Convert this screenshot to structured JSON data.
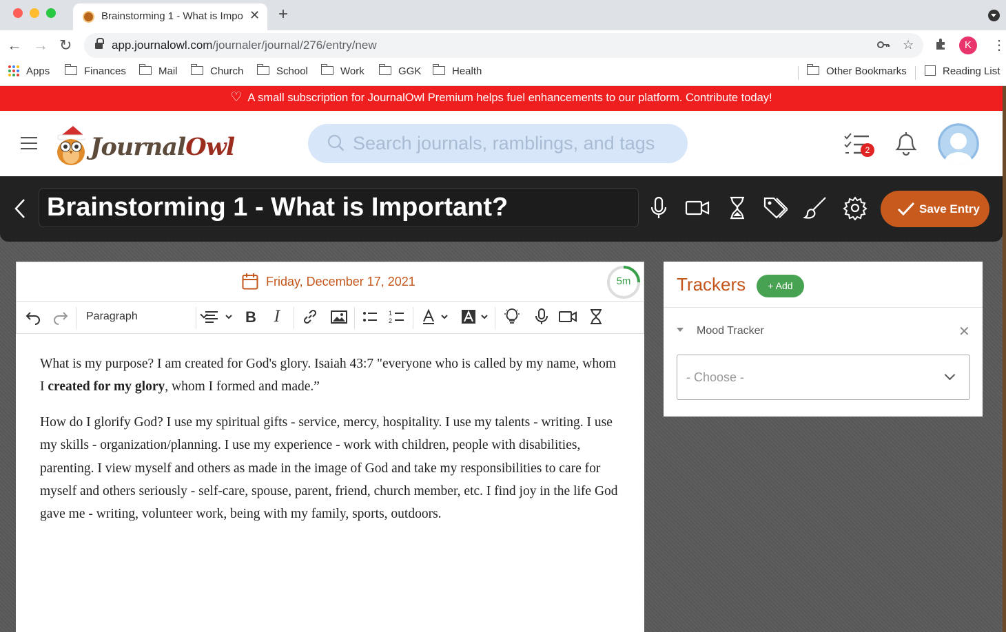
{
  "browser": {
    "tab_title": "Brainstorming 1 - What is Impo",
    "url_host": "app.journalowl.com",
    "url_path": "/journaler/journal/276/entry/new",
    "profile_initial": "K",
    "bookmarks": [
      "Apps",
      "Finances",
      "Mail",
      "Church",
      "School",
      "Work",
      "GGK",
      "Health"
    ],
    "other_bookmarks": "Other Bookmarks",
    "reading_list": "Reading List"
  },
  "banner": {
    "text": "A small subscription for JournalOwl Premium helps fuel enhancements to our platform. Contribute today!",
    "color": "#f01f1f"
  },
  "header": {
    "logo_part1": "Journal",
    "logo_part2": "Owl",
    "search_placeholder": "Search journals, ramblings, and tags",
    "task_badge": "2"
  },
  "entry": {
    "title": "Brainstorming 1 - What is Important?",
    "save_label": "Save Entry",
    "accent": "#c85a1e",
    "toolbar_icons": [
      "microphone-icon",
      "video-icon",
      "hourglass-icon",
      "tags-icon",
      "brush-icon",
      "gear-icon"
    ]
  },
  "editor": {
    "date": "Friday, December 17, 2021",
    "timer": "5m",
    "timer_progress": 0.25,
    "paragraph_style": "Paragraph",
    "p1_a": "What is my purpose? I am created for God's glory. Isaiah 43:7 \"everyone who is called by my name, whom I ",
    "p1_bold": "created for my glory",
    "p1_b": ", whom I formed and made.”",
    "p2": "How do I glorify God? I use my spiritual gifts - service, mercy, hospitality. I use my talents - writing. I use my skills - organization/planning. I use my experience - work with children, people with disabilities, parenting. I view myself and others as made in the image of God and take my responsibilities to care for myself and others seriously - self-care, spouse, parent, friend, church member, etc. I find joy in the life God gave me - writing, volunteer work, being with my family, sports, outdoors."
  },
  "trackers": {
    "title": "Trackers",
    "add_label": "+ Add",
    "item_name": "Mood Tracker",
    "select_placeholder": "- Choose -"
  }
}
